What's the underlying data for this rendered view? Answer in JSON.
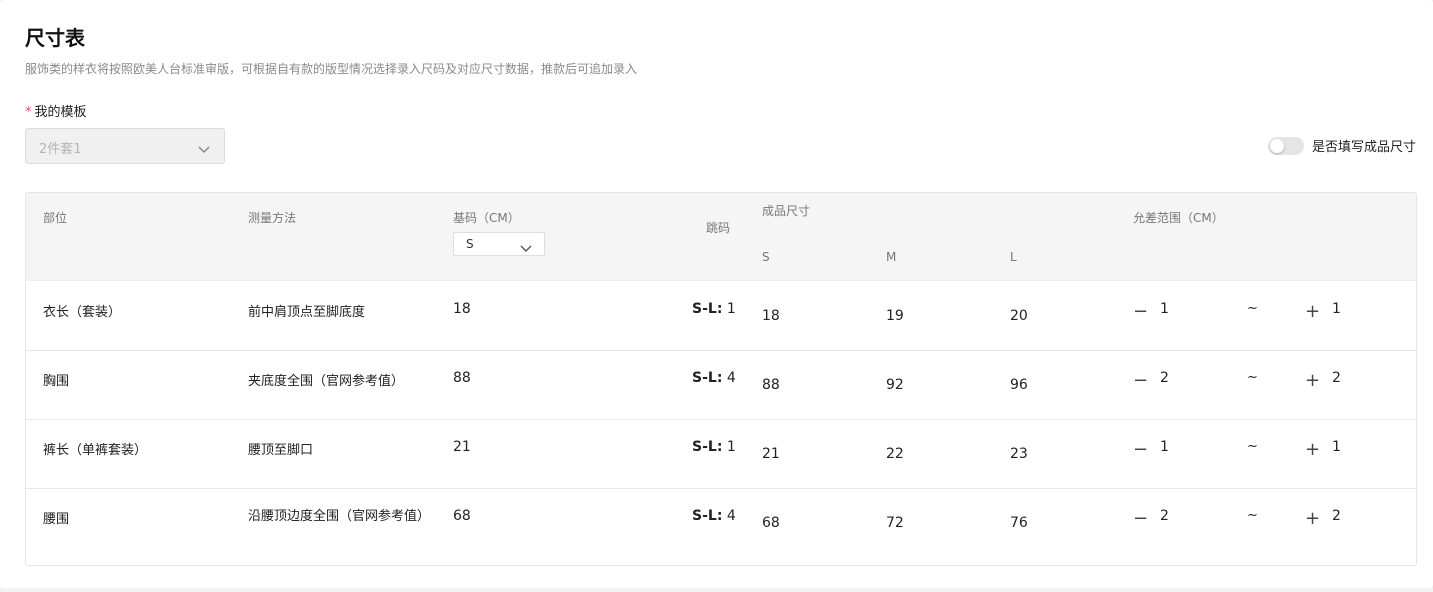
{
  "header": {
    "title": "尺寸表",
    "subtitle": "服饰类的样衣将按照欧美人台标准审版，可根据自有款的版型情况选择录入尺码及对应尺寸数据，推款后可追加录入"
  },
  "template": {
    "required_mark": "*",
    "label": "我的模板",
    "selected": "2件套1"
  },
  "toggle": {
    "label": "是否填写成品尺寸",
    "on": false
  },
  "table": {
    "headers": {
      "part": "部位",
      "method": "测量方法",
      "base": "基码（CM）",
      "base_size": "S",
      "jump": "跳码",
      "finished": "成品尺寸",
      "sizes": [
        "S",
        "M",
        "L"
      ],
      "tolerance": "允差范围（CM）"
    },
    "rows": [
      {
        "part": "衣长（套装）",
        "method": "前中肩顶点至脚底度",
        "base": "18",
        "jump_label": "S-L:",
        "jump_value": "1",
        "sizes": [
          "18",
          "19",
          "20"
        ],
        "minus": "1",
        "tilde": "~",
        "plus": "1"
      },
      {
        "part": "胸围",
        "method": "夹底度全围（官网参考值）",
        "base": "88",
        "jump_label": "S-L:",
        "jump_value": "4",
        "sizes": [
          "88",
          "92",
          "96"
        ],
        "minus": "2",
        "tilde": "~",
        "plus": "2"
      },
      {
        "part": "裤长（单裤套装）",
        "method": "腰顶至脚口",
        "base": "21",
        "jump_label": "S-L:",
        "jump_value": "1",
        "sizes": [
          "21",
          "22",
          "23"
        ],
        "minus": "1",
        "tilde": "~",
        "plus": "1"
      },
      {
        "part": "腰围",
        "method": "沿腰顶边度全围（官网参考值）",
        "base": "68",
        "jump_label": "S-L:",
        "jump_value": "4",
        "sizes": [
          "68",
          "72",
          "76"
        ],
        "minus": "2",
        "tilde": "~",
        "plus": "2"
      }
    ]
  }
}
